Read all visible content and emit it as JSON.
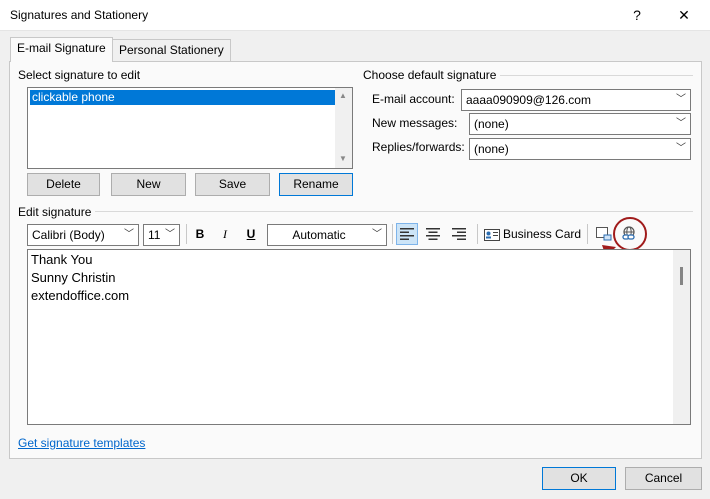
{
  "window": {
    "title": "Signatures and Stationery",
    "help": "?",
    "close": "✕"
  },
  "tabs": [
    {
      "label": "E-mail Signature"
    },
    {
      "label": "Personal Stationery"
    }
  ],
  "select_signature": {
    "label": "Select signature to edit",
    "items": [
      "clickable phone"
    ],
    "buttons": {
      "delete": "Delete",
      "new": "New",
      "save": "Save",
      "rename": "Rename"
    }
  },
  "default_signature": {
    "label": "Choose default signature",
    "email_account_label": "E-mail account:",
    "email_account_value": "aaaa090909@126.com",
    "new_messages_label": "New messages:",
    "new_messages_value": "(none)",
    "replies_label": "Replies/forwards:",
    "replies_value": "(none)"
  },
  "edit_signature": {
    "label": "Edit signature",
    "font": "Calibri (Body)",
    "size": "11",
    "bold": "B",
    "italic": "I",
    "underline": "U",
    "color": "Automatic",
    "business_card": "Business Card",
    "text_lines": [
      "Thank You",
      "Sunny Christin",
      "extendoffice.com"
    ]
  },
  "templates_link": "Get signature templates",
  "footer": {
    "ok": "OK",
    "cancel": "Cancel"
  },
  "colors": {
    "accent": "#0078d7",
    "annotation": "#a01b1b",
    "link": "#0066cc"
  }
}
